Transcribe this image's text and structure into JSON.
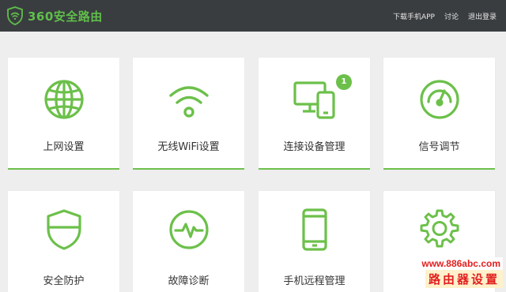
{
  "header": {
    "brand": "360安全路由",
    "links": [
      "下载手机APP",
      "讨论",
      "退出登录"
    ]
  },
  "tiles": [
    {
      "label": "上网设置",
      "icon": "globe-icon"
    },
    {
      "label": "无线WiFi设置",
      "icon": "wifi-icon"
    },
    {
      "label": "连接设备管理",
      "icon": "devices-icon",
      "badge": "1"
    },
    {
      "label": "信号调节",
      "icon": "signal-gauge-icon"
    },
    {
      "label": "安全防护",
      "icon": "shield-icon"
    },
    {
      "label": "故障诊断",
      "icon": "diagnosis-pulse-icon"
    },
    {
      "label": "手机远程管理",
      "icon": "phone-icon"
    },
    {
      "label": "",
      "icon": "settings-gear-icon"
    }
  ],
  "watermark": {
    "url": "www.886abc.com",
    "title": "路由器设置"
  },
  "colors": {
    "accent": "#6cc04a",
    "topbar": "#3a3d40",
    "background": "#eeeeee",
    "watermark": "#e21f1f"
  }
}
